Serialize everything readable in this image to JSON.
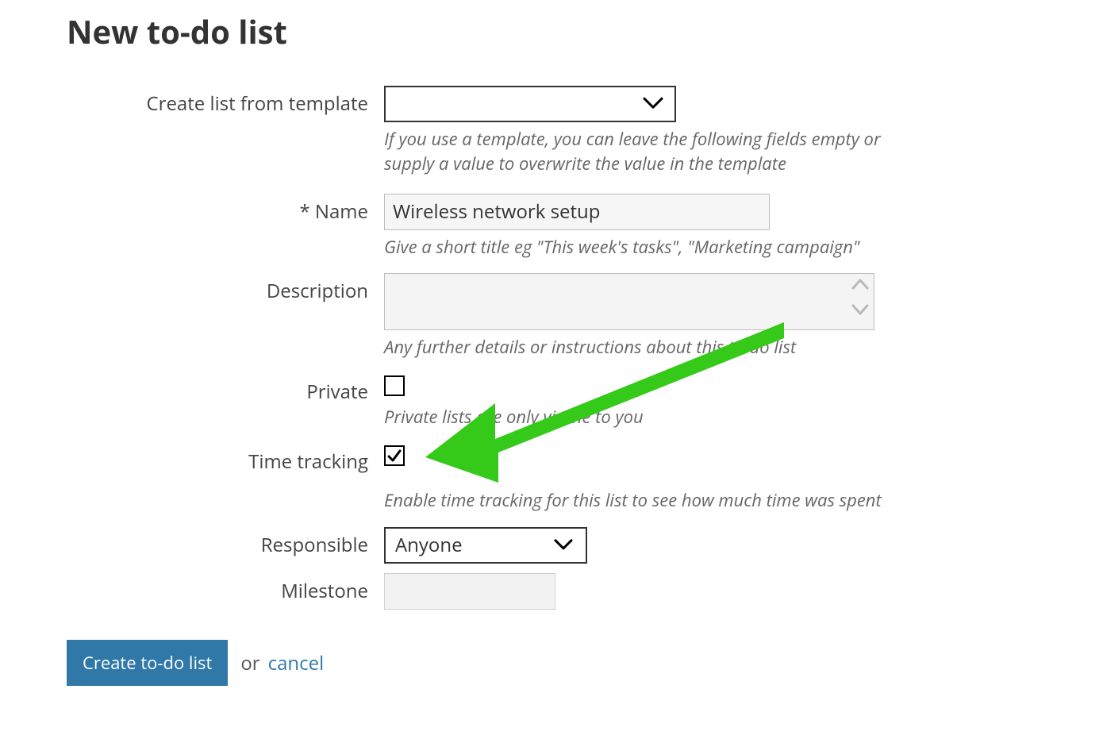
{
  "header": {
    "title": "New to-do list"
  },
  "fields": {
    "template": {
      "label": "Create list from template",
      "hint": "If you use a template, you can leave the following fields empty or supply a value to overwrite the value in the template"
    },
    "name": {
      "label": "* Name",
      "value": "Wireless network setup",
      "hint": "Give a short title eg \"This week's tasks\", \"Marketing campaign\""
    },
    "description": {
      "label": "Description",
      "value": "",
      "hint": "Any further details or instructions about this to-do list"
    },
    "private": {
      "label": "Private",
      "checked": false,
      "hint": "Private lists are only visible to you"
    },
    "time_tracking": {
      "label": "Time tracking",
      "checked": true,
      "hint": "Enable time tracking for this list to see how much time was spent"
    },
    "responsible": {
      "label": "Responsible",
      "value": "Anyone"
    },
    "milestone": {
      "label": "Milestone",
      "value": ""
    }
  },
  "footer": {
    "submit": "Create to-do list",
    "or": "or",
    "cancel": "cancel"
  },
  "annotation": {
    "arrow_color": "#35c91a"
  }
}
